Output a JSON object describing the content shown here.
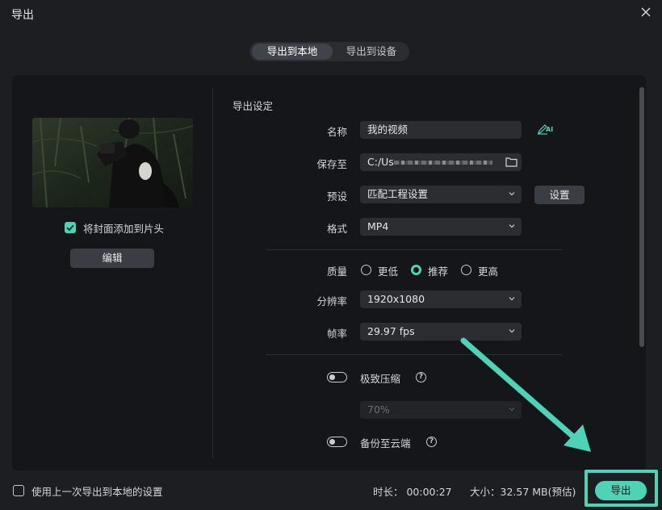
{
  "window": {
    "title": "导出"
  },
  "tabs": [
    {
      "label": "导出到本地",
      "active": true
    },
    {
      "label": "导出到设备",
      "active": false
    }
  ],
  "left": {
    "cover_checkbox_label": "将封面添加到片头",
    "cover_checked": true,
    "edit_button": "编辑"
  },
  "settings": {
    "section_title": "导出设定",
    "name": {
      "label": "名称",
      "value": "我的视频",
      "ai_icon_text": "AI"
    },
    "save_to": {
      "label": "保存至",
      "value": "C:/Us"
    },
    "preset": {
      "label": "预设",
      "value": "匹配工程设置",
      "button": "设置"
    },
    "format": {
      "label": "格式",
      "value": "MP4"
    },
    "quality": {
      "label": "质量",
      "options": [
        "更低",
        "推荐",
        "更高"
      ],
      "selected": "推荐"
    },
    "resolution": {
      "label": "分辨率",
      "value": "1920x1080"
    },
    "framerate": {
      "label": "帧率",
      "value": "29.97 fps"
    },
    "extreme_compress": {
      "label": "极致压缩",
      "enabled": false,
      "help": "?"
    },
    "compress_ratio": {
      "value": "70%",
      "disabled": true
    },
    "cloud_backup": {
      "label": "备份至云端",
      "enabled": false,
      "help": "?"
    }
  },
  "footer": {
    "reuse_label": "使用上一次导出到本地的设置",
    "reuse_checked": false,
    "duration": "时长： 00:00:27",
    "size": "大小：32.57 MB(预估)",
    "export_button": "导出"
  },
  "colors": {
    "accent": "#4fd3b7",
    "background": "#1c1e22",
    "panel": "#15161a"
  }
}
